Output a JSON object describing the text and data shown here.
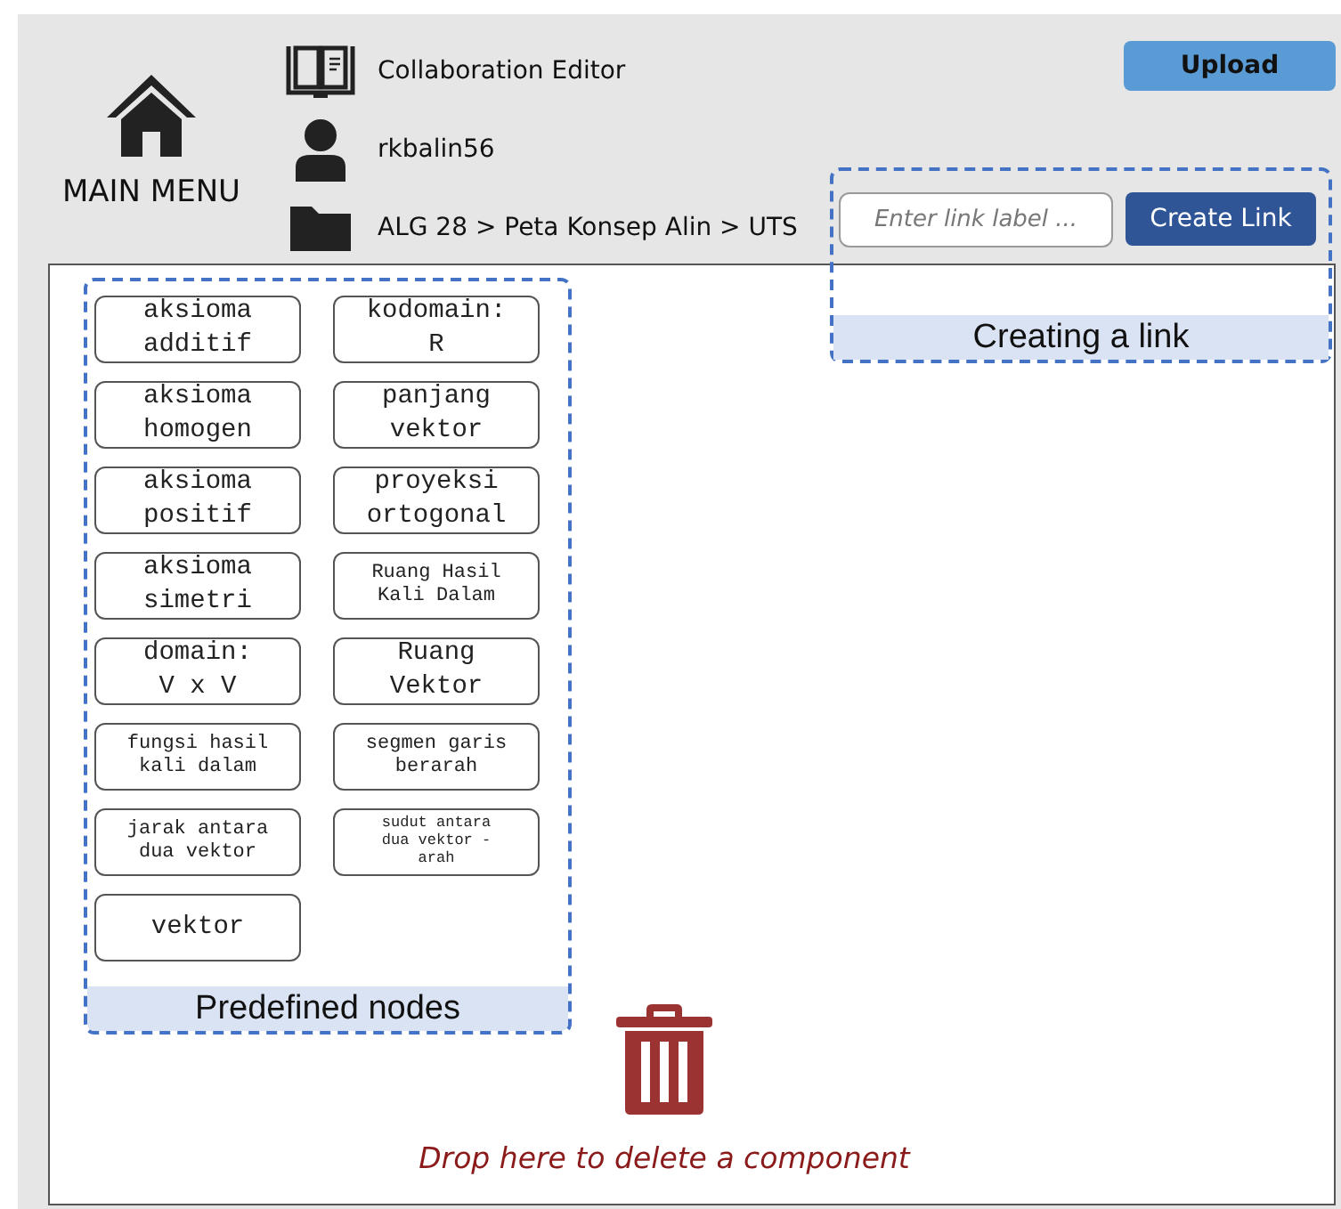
{
  "header": {
    "home_label": "MAIN MENU",
    "editor_title": "Collaboration Editor",
    "username": "rkbalin56",
    "breadcrumb": "ALG 28 > Peta Konsep Alin > UTS",
    "upload_button": "Upload"
  },
  "link_panel": {
    "placeholder": "Enter link label ...",
    "create_button": "Create Link",
    "caption": "Creating a link"
  },
  "predefined_nodes": {
    "caption": "Predefined nodes",
    "nodes": [
      {
        "lines": [
          "aksioma",
          "additif"
        ],
        "kind": "large"
      },
      {
        "lines": [
          "kodomain:",
          "R"
        ],
        "kind": "large"
      },
      {
        "lines": [
          "aksioma",
          "homogen"
        ],
        "kind": "large"
      },
      {
        "lines": [
          "panjang",
          "vektor"
        ],
        "kind": "large"
      },
      {
        "lines": [
          "aksioma",
          "positif"
        ],
        "kind": "large"
      },
      {
        "lines": [
          "proyeksi",
          "ortogonal"
        ],
        "kind": "large"
      },
      {
        "lines": [
          "aksioma",
          "simetri"
        ],
        "kind": "large"
      },
      {
        "lines": [
          "Ruang Hasil",
          "Kali Dalam"
        ],
        "kind": "small"
      },
      {
        "lines": [
          "domain:",
          "V x V"
        ],
        "kind": "large"
      },
      {
        "lines": [
          "Ruang",
          "Vektor"
        ],
        "kind": "large"
      },
      {
        "lines": [
          "fungsi hasil",
          "kali dalam"
        ],
        "kind": "small"
      },
      {
        "lines": [
          "segmen garis",
          "berarah"
        ],
        "kind": "small"
      },
      {
        "lines": [
          "jarak antara",
          "dua vektor"
        ],
        "kind": "small"
      },
      {
        "lines": [
          "sudut antara",
          "dua vektor -",
          "arah"
        ],
        "kind": "tiny"
      },
      {
        "lines": [
          "vektor"
        ],
        "kind": "large"
      }
    ]
  },
  "trash": {
    "hint": "Drop here to delete a component"
  }
}
